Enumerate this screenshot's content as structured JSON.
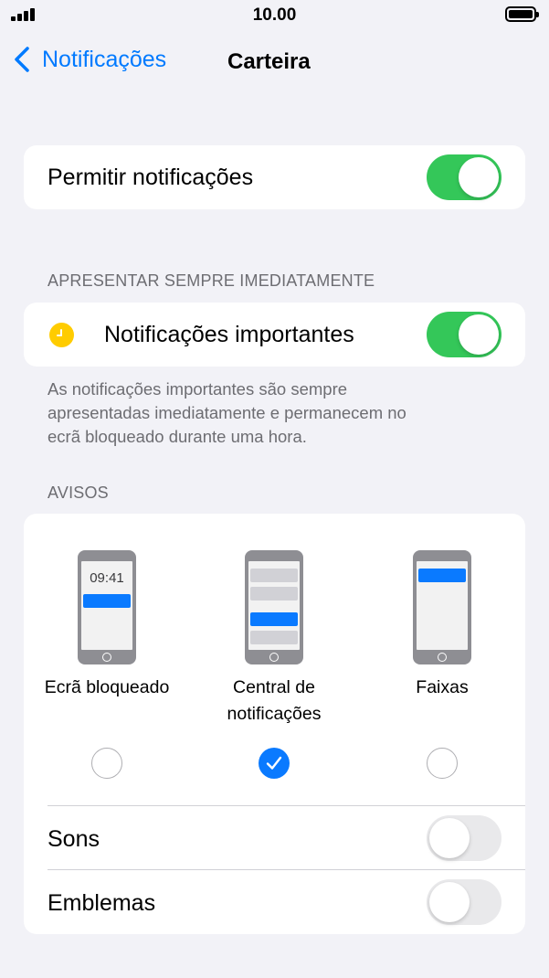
{
  "status_bar": {
    "time": "10.00"
  },
  "nav": {
    "back_label": "Notificações",
    "title": "Carteira"
  },
  "allow": {
    "label": "Permitir notificações",
    "toggle_on": true
  },
  "important_section": {
    "header": "APRESENTAR SEMPRE IMEDIATAMENTE",
    "label": "Notificações importantes",
    "toggle_on": true,
    "footer_line1": "As notificações importantes são sempre",
    "footer_line2": "apresentadas imediatamente e permanecem no",
    "footer_line3": "ecrã bloqueado durante uma hora."
  },
  "alerts": {
    "header": "AVISOS",
    "lock_screen_time": "09:41",
    "styles": [
      {
        "label": "Ecrã bloqueado",
        "selected": false
      },
      {
        "label_line1": "Central de",
        "label_line2": "notificações",
        "selected": true
      },
      {
        "label": "Faixas",
        "selected": false
      }
    ],
    "sounds": {
      "label": "Sons",
      "toggle_on": false
    },
    "badges": {
      "label": "Emblemas",
      "toggle_on": false
    }
  },
  "colors": {
    "accent": "#007aff",
    "toggle_on": "#34c759",
    "icon_yellow": "#ffcc00"
  },
  "icons": {
    "back": "chevron-left-icon",
    "important": "clock-icon",
    "checked": "checkmark-icon"
  }
}
